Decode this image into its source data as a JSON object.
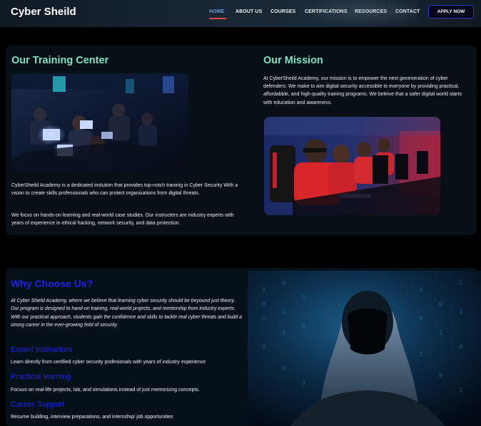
{
  "header": {
    "logo": "Cyber Sheild",
    "nav": [
      "HOME",
      "ABOUT US",
      "COURSES",
      "CERTIFICATIONS",
      "RESOURCES",
      "CONTACT"
    ],
    "active_nav": "HOME",
    "apply_label": "APPLY NOW"
  },
  "training_center": {
    "title": "Our Training Center",
    "image_alt": "training-room-photo",
    "paragraphs": [
      "CyberSheild Academy is a dedicated instution that provides top-notch traninig in Cyber Security With a vision to create skills professionals who can protect organizations from digital threats.",
      "We focus on hands-on learning and real-world case studies. Our instructers are industry experts with years of experience in ethical hacking, network security, and data protection."
    ]
  },
  "mission": {
    "title": "Our Mission",
    "paragraph": "At CyberSheild Academy, our mission is to empower the next geneneration of cyber defenders. We make to aim digital security accessible to everyone by providing practical, affordabble, and high-quality training programs. We beleive that a safer digital world starts with education and awareness.",
    "image_alt": "gaming-students-photo"
  },
  "why_choose": {
    "title": "Why Choose Us?",
    "intro": "At Cyber Shield Academy, where we believe that learning cyber security should be beyound just theory. Our program is designed to hand-on training, real-world projects, and mentorship from industry experts. With our practical approach, students gain the confidence and skills to tackle real cyber threats and build a strong career in the ever-growing feild of security.",
    "features": [
      {
        "title": "Expert Instructors",
        "desc": "Learn directly from certified cyber security profesionals with years of industry experience"
      },
      {
        "title": "Practical learning",
        "desc": "Focuus on real-life projects, lab, and simulations instead of just memorizing concepts."
      },
      {
        "title": "Career Support",
        "desc": "Resume building, interview preparations, and internship/ job opportunities"
      }
    ],
    "image_alt": "hooded-hacker-image"
  },
  "colors": {
    "teal_heading": "#7ee3c4",
    "blue_heading": "#1b21e8",
    "apply_border": "#2a36c8",
    "active_nav": "#6f9dd6",
    "nav_underline": "#e0493e"
  }
}
